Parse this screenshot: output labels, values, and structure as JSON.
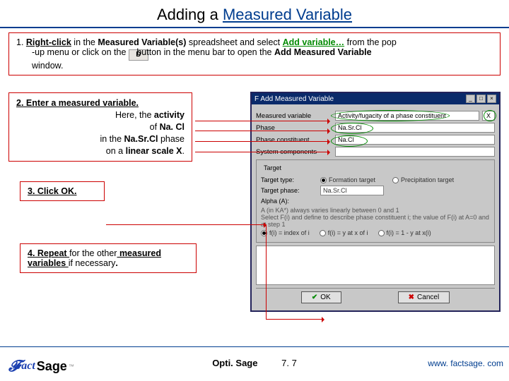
{
  "title_plain": "Adding a ",
  "title_underlined": "Measured Variable",
  "step1": {
    "p1a": "1.  ",
    "p1b": "Right-click",
    "p1c": " in the ",
    "p1d": "Measured Variable(s)",
    "p1e": " spreadsheet and select ",
    "p1f": "Add variable…",
    "p1g": " from the pop",
    "p2a": "-up menu or click on the ",
    "p2b": "button",
    "p2c": " in the menu bar to open the ",
    "p2d": "Add Measured Variable",
    "p3a": "window."
  },
  "step2": {
    "l1": "2.  Enter a measured variable.",
    "l2a": "Here, the ",
    "l2b": "activity",
    "l3a": "of ",
    "l3b": "Na. Cl",
    "l4a": "in the ",
    "l4b": "Na.Sr.Cl",
    "l4c": " phase",
    "l5a": "on a ",
    "l5b": "linear scale X",
    "l5c": "."
  },
  "step3": "3.  Click OK.",
  "step4": {
    "a": "4.  Repeat ",
    "b": "for the other",
    "c": " measured variables ",
    "d": "if necessary",
    "e": "."
  },
  "dialog": {
    "title": "F Add Measured Variable",
    "rows": {
      "mv_label": "Measured variable",
      "mv_value": "Activity/fugacity of a phase constituent",
      "x_chip": "X",
      "phase_label": "Phase",
      "phase_value": "Na.Sr.Cl",
      "pc_label": "Phase constituent",
      "pc_value": "Na.Cl",
      "sc_label": "System components",
      "sc_value": ""
    },
    "target_group": "Target",
    "target_type_label": "Target type:",
    "target_phase_label": "Target phase:",
    "target_phase_value": "Na.Sr.Cl",
    "alpha_label": "Alpha (A):",
    "r_formation": "Formation target",
    "r_precip": "Precipitation target",
    "hint1": "A (in KA*) always varies linearly between 0 and 1",
    "hint2": "Select F(i) and define to describe phase constituent i; the value of F(i) at A=0 and at step 1",
    "r1": "f(i) = index of i",
    "r2": "f(i) = y at x of i",
    "r3": "f(i) = 1 - y at x(i)",
    "ok": "OK",
    "cancel": "Cancel"
  },
  "footer": {
    "product": "Opti. Sage",
    "section": "7. 7",
    "url": "www. factsage. com",
    "logo_f": "F",
    "logo_act": "act",
    "logo_sage": "Sage",
    "logo_tm": "™"
  }
}
